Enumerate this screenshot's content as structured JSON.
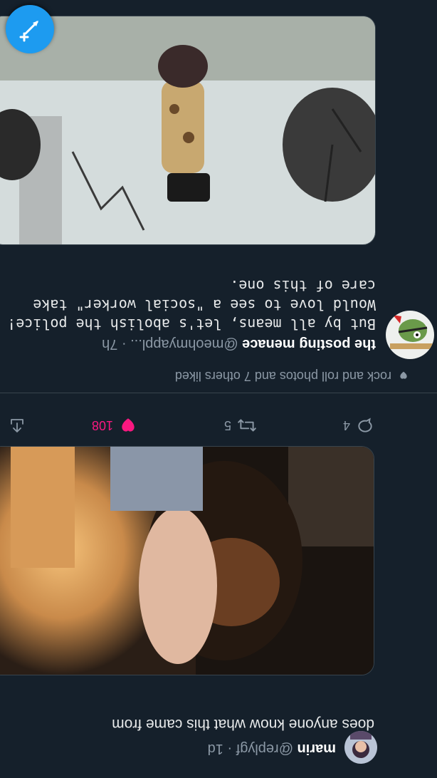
{
  "tweets": [
    {
      "name": "marin",
      "handle_time": "@replygf · 1d",
      "text": "does anyone know what this came from",
      "image_desc": "Close-up photo of a person with curly hair holding an ornate illuminated object",
      "actions": {
        "replies": "4",
        "retweets": "5",
        "likes": "108"
      }
    },
    {
      "social_context": "rock and roll photos and 7 others liked",
      "name": "the posting menace",
      "handle_time": "@meohmyappl... · 7h",
      "text": "But by all means, let's abolish the police!\nWould love to see a \"social worker\" take\ncare of this one.",
      "image_desc": "Photo of a costumed performer in a large cylindrical suit on a studio stage with lighting umbrellas"
    }
  ],
  "colors": {
    "background": "#15202b",
    "accent": "#1d9bf0",
    "like": "#f91880",
    "muted": "#8b98a5",
    "divider": "#38444d"
  },
  "icons": [
    "reply-icon",
    "retweet-icon",
    "heart-icon",
    "share-icon",
    "compose-icon"
  ]
}
